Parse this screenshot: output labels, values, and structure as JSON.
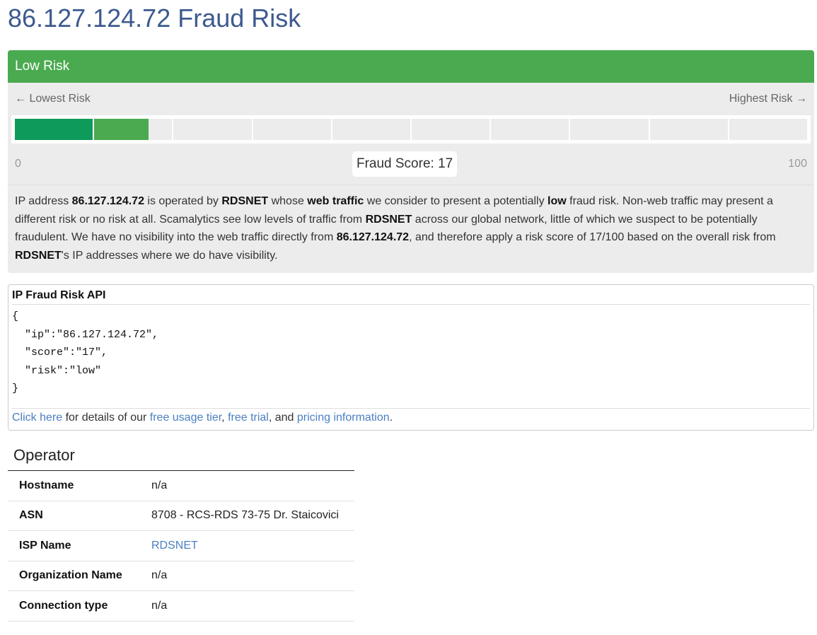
{
  "page_title": "86.127.124.72 Fraud Risk",
  "risk": {
    "level_label": "Low Risk",
    "lowest_label": "← Lowest Risk",
    "highest_label": "Highest Risk →",
    "scale_min": "0",
    "scale_max": "100",
    "score_label": "Fraud Score: 17",
    "score": 17,
    "colors": {
      "header": "#4aaa4f",
      "fill_dark": "#0e9a5a",
      "fill_light": "#4aaa4f"
    }
  },
  "description": {
    "p1": "IP address ",
    "ip1": "86.127.124.72",
    "p2": " is operated by ",
    "op1": "RDSNET",
    "p3": " whose ",
    "wt": "web traffic",
    "p4": " we consider to present a potentially ",
    "low": "low",
    "p5": " fraud risk. Non-web traffic may present a different risk or no risk at all. Scamalytics see low levels of traffic from ",
    "op2": "RDSNET",
    "p6": " across our global network, little of which we suspect to be potentially fraudulent. We have no visibility into the web traffic directly from ",
    "ip2": "86.127.124.72",
    "p7": ", and therefore apply a risk score of 17/100 based on the overall risk from ",
    "op3": "RDSNET",
    "p8": "'s IP addresses where we do have visibility."
  },
  "api": {
    "title": "IP Fraud Risk API",
    "json_text": "{\n  \"ip\":\"86.127.124.72\",\n  \"score\":\"17\",\n  \"risk\":\"low\"\n}",
    "link_click_here": "Click here",
    "text_1": " for details of our ",
    "link_free_tier": "free usage tier",
    "text_2": ", ",
    "link_free_trial": "free trial",
    "text_3": ", and ",
    "link_pricing": "pricing information",
    "text_4": "."
  },
  "operator": {
    "title": "Operator",
    "rows": [
      {
        "key": "Hostname",
        "value": "n/a"
      },
      {
        "key": "ASN",
        "value": "8708 - RCS-RDS 73-75 Dr. Staicovici"
      },
      {
        "key": "ISP Name",
        "value": "RDSNET"
      },
      {
        "key": "Organization Name",
        "value": "n/a"
      },
      {
        "key": "Connection type",
        "value": "n/a"
      }
    ]
  }
}
